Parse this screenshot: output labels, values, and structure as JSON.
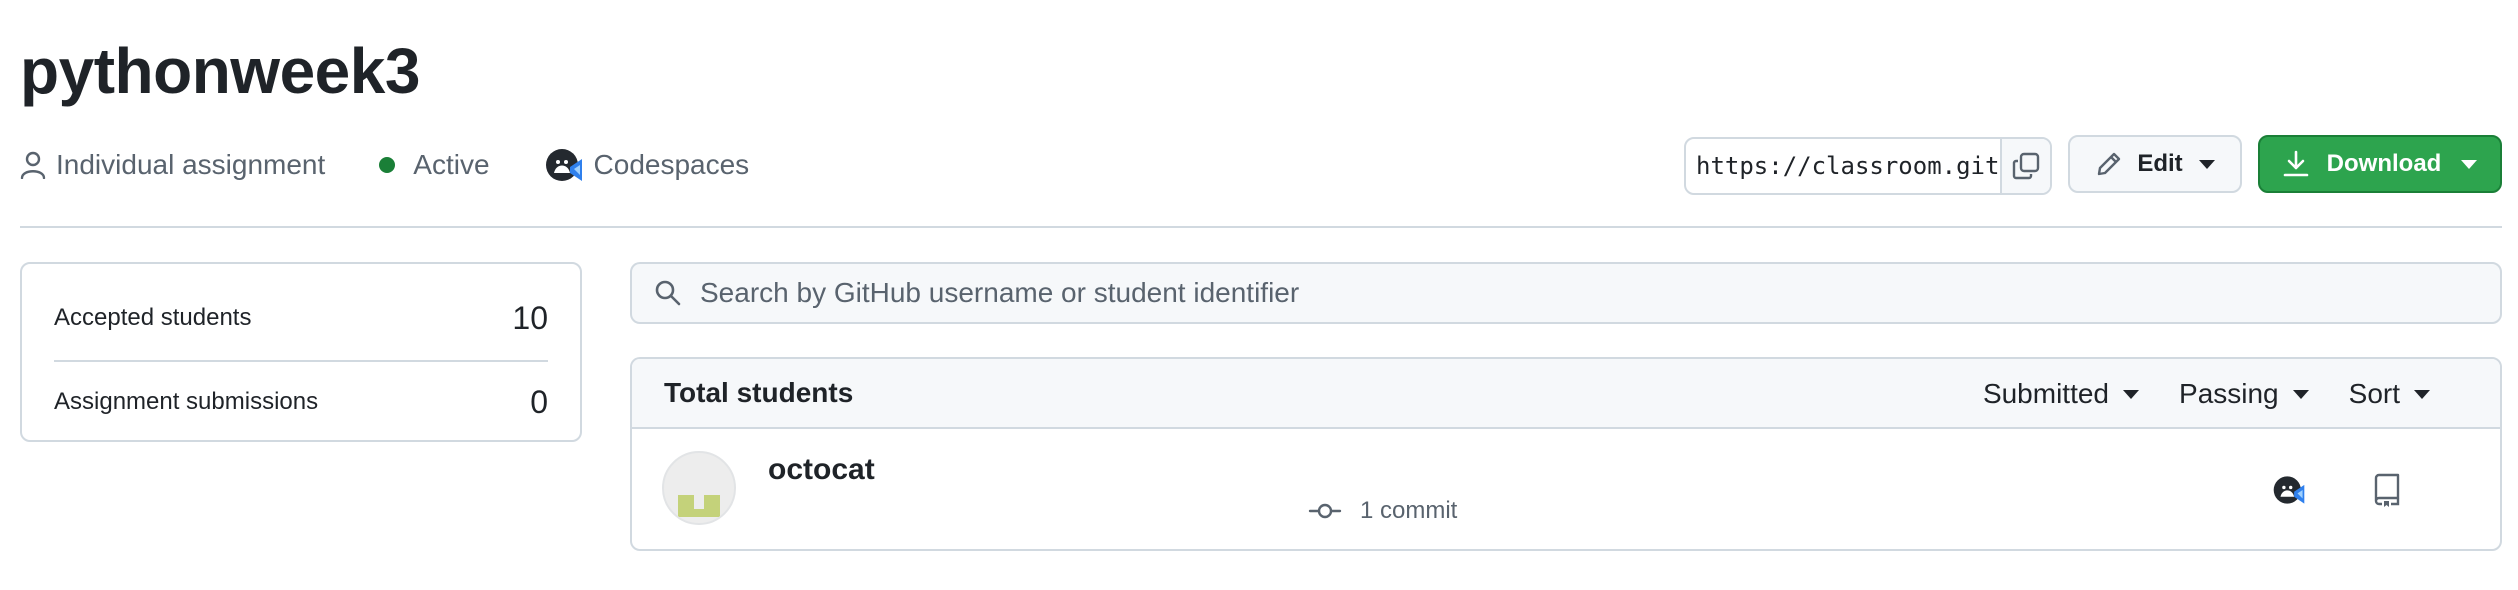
{
  "assignment": {
    "title": "pythonweek3",
    "type_label": "Individual assignment",
    "status_label": "Active",
    "status_color": "#1a7f37",
    "editor_label": "Codespaces"
  },
  "actions": {
    "invite_url": "https://classroom.github.com/a/",
    "edit_label": "Edit",
    "download_label": "Download",
    "accent_color": "#2da44e"
  },
  "stats": [
    {
      "label": "Accepted students",
      "value": "10"
    },
    {
      "label": "Assignment submissions",
      "value": "0"
    }
  ],
  "search": {
    "placeholder": "Search by GitHub username or student identifier"
  },
  "table": {
    "title": "Total students",
    "filters": [
      "Submitted",
      "Passing",
      "Sort"
    ],
    "rows": [
      {
        "username": "octocat",
        "commits": "1 commit"
      }
    ]
  }
}
